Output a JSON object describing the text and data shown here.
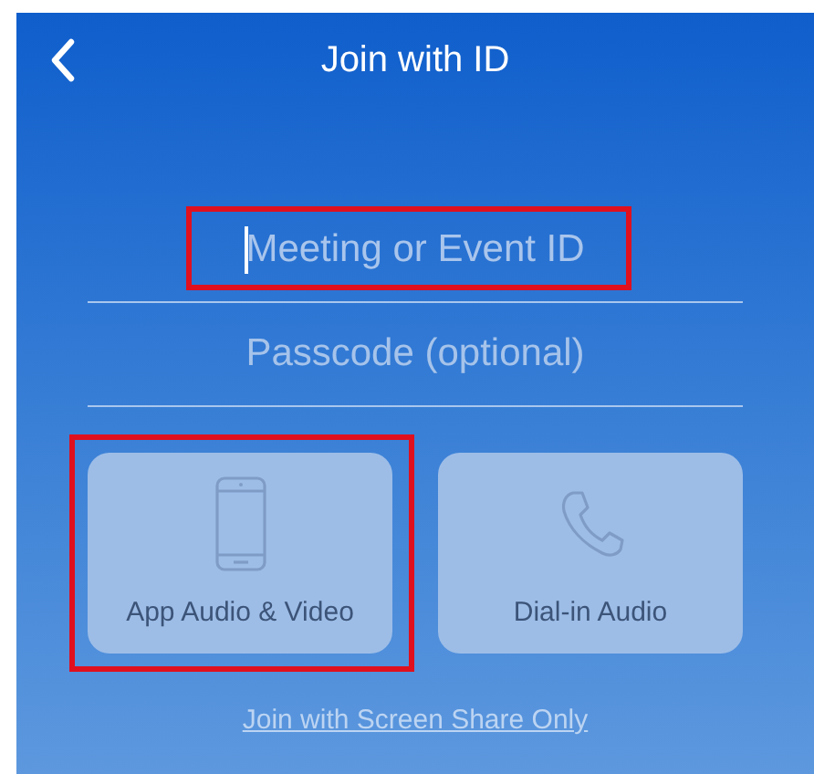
{
  "header": {
    "title": "Join with ID"
  },
  "fields": [
    {
      "placeholder": "Meeting or Event ID",
      "focused": true,
      "highlighted": true
    },
    {
      "placeholder": "Passcode (optional)",
      "focused": false,
      "highlighted": false
    }
  ],
  "options": [
    {
      "label": "App Audio & Video",
      "kind": "phone",
      "highlighted": true
    },
    {
      "label": "Dial-in Audio",
      "kind": "call",
      "highlighted": false
    }
  ],
  "link": "Join with Screen Share Only"
}
